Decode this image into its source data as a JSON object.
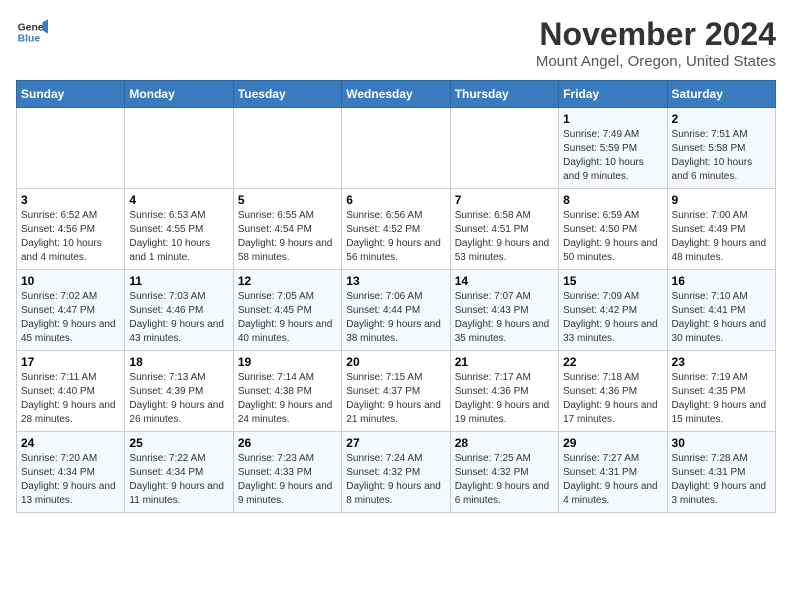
{
  "logo": {
    "line1": "General",
    "line2": "Blue"
  },
  "title": "November 2024",
  "subtitle": "Mount Angel, Oregon, United States",
  "days_of_week": [
    "Sunday",
    "Monday",
    "Tuesday",
    "Wednesday",
    "Thursday",
    "Friday",
    "Saturday"
  ],
  "weeks": [
    [
      {
        "day": "",
        "info": ""
      },
      {
        "day": "",
        "info": ""
      },
      {
        "day": "",
        "info": ""
      },
      {
        "day": "",
        "info": ""
      },
      {
        "day": "",
        "info": ""
      },
      {
        "day": "1",
        "info": "Sunrise: 7:49 AM\nSunset: 5:59 PM\nDaylight: 10 hours and 9 minutes."
      },
      {
        "day": "2",
        "info": "Sunrise: 7:51 AM\nSunset: 5:58 PM\nDaylight: 10 hours and 6 minutes."
      }
    ],
    [
      {
        "day": "3",
        "info": "Sunrise: 6:52 AM\nSunset: 4:56 PM\nDaylight: 10 hours and 4 minutes."
      },
      {
        "day": "4",
        "info": "Sunrise: 6:53 AM\nSunset: 4:55 PM\nDaylight: 10 hours and 1 minute."
      },
      {
        "day": "5",
        "info": "Sunrise: 6:55 AM\nSunset: 4:54 PM\nDaylight: 9 hours and 58 minutes."
      },
      {
        "day": "6",
        "info": "Sunrise: 6:56 AM\nSunset: 4:52 PM\nDaylight: 9 hours and 56 minutes."
      },
      {
        "day": "7",
        "info": "Sunrise: 6:58 AM\nSunset: 4:51 PM\nDaylight: 9 hours and 53 minutes."
      },
      {
        "day": "8",
        "info": "Sunrise: 6:59 AM\nSunset: 4:50 PM\nDaylight: 9 hours and 50 minutes."
      },
      {
        "day": "9",
        "info": "Sunrise: 7:00 AM\nSunset: 4:49 PM\nDaylight: 9 hours and 48 minutes."
      }
    ],
    [
      {
        "day": "10",
        "info": "Sunrise: 7:02 AM\nSunset: 4:47 PM\nDaylight: 9 hours and 45 minutes."
      },
      {
        "day": "11",
        "info": "Sunrise: 7:03 AM\nSunset: 4:46 PM\nDaylight: 9 hours and 43 minutes."
      },
      {
        "day": "12",
        "info": "Sunrise: 7:05 AM\nSunset: 4:45 PM\nDaylight: 9 hours and 40 minutes."
      },
      {
        "day": "13",
        "info": "Sunrise: 7:06 AM\nSunset: 4:44 PM\nDaylight: 9 hours and 38 minutes."
      },
      {
        "day": "14",
        "info": "Sunrise: 7:07 AM\nSunset: 4:43 PM\nDaylight: 9 hours and 35 minutes."
      },
      {
        "day": "15",
        "info": "Sunrise: 7:09 AM\nSunset: 4:42 PM\nDaylight: 9 hours and 33 minutes."
      },
      {
        "day": "16",
        "info": "Sunrise: 7:10 AM\nSunset: 4:41 PM\nDaylight: 9 hours and 30 minutes."
      }
    ],
    [
      {
        "day": "17",
        "info": "Sunrise: 7:11 AM\nSunset: 4:40 PM\nDaylight: 9 hours and 28 minutes."
      },
      {
        "day": "18",
        "info": "Sunrise: 7:13 AM\nSunset: 4:39 PM\nDaylight: 9 hours and 26 minutes."
      },
      {
        "day": "19",
        "info": "Sunrise: 7:14 AM\nSunset: 4:38 PM\nDaylight: 9 hours and 24 minutes."
      },
      {
        "day": "20",
        "info": "Sunrise: 7:15 AM\nSunset: 4:37 PM\nDaylight: 9 hours and 21 minutes."
      },
      {
        "day": "21",
        "info": "Sunrise: 7:17 AM\nSunset: 4:36 PM\nDaylight: 9 hours and 19 minutes."
      },
      {
        "day": "22",
        "info": "Sunrise: 7:18 AM\nSunset: 4:36 PM\nDaylight: 9 hours and 17 minutes."
      },
      {
        "day": "23",
        "info": "Sunrise: 7:19 AM\nSunset: 4:35 PM\nDaylight: 9 hours and 15 minutes."
      }
    ],
    [
      {
        "day": "24",
        "info": "Sunrise: 7:20 AM\nSunset: 4:34 PM\nDaylight: 9 hours and 13 minutes."
      },
      {
        "day": "25",
        "info": "Sunrise: 7:22 AM\nSunset: 4:34 PM\nDaylight: 9 hours and 11 minutes."
      },
      {
        "day": "26",
        "info": "Sunrise: 7:23 AM\nSunset: 4:33 PM\nDaylight: 9 hours and 9 minutes."
      },
      {
        "day": "27",
        "info": "Sunrise: 7:24 AM\nSunset: 4:32 PM\nDaylight: 9 hours and 8 minutes."
      },
      {
        "day": "28",
        "info": "Sunrise: 7:25 AM\nSunset: 4:32 PM\nDaylight: 9 hours and 6 minutes."
      },
      {
        "day": "29",
        "info": "Sunrise: 7:27 AM\nSunset: 4:31 PM\nDaylight: 9 hours and 4 minutes."
      },
      {
        "day": "30",
        "info": "Sunrise: 7:28 AM\nSunset: 4:31 PM\nDaylight: 9 hours and 3 minutes."
      }
    ]
  ]
}
